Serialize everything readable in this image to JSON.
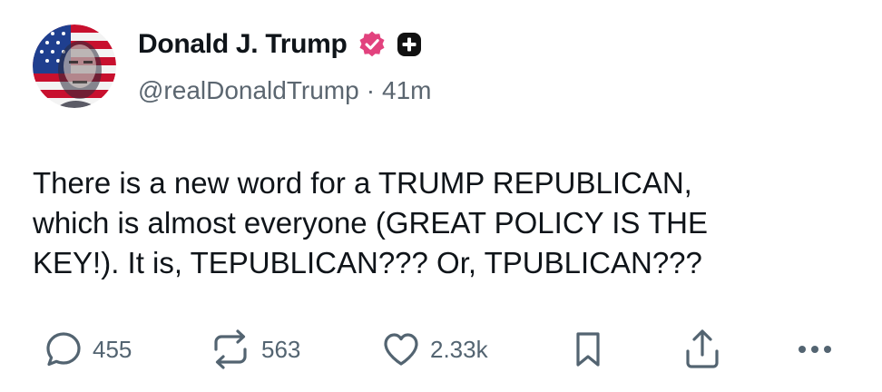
{
  "post": {
    "author_name": "Donald J. Trump",
    "handle": "@realDonaldTrump",
    "separator": "·",
    "timestamp": "41m",
    "text": "There is a new word for a TRUMP REPUBLICAN,\nwhich is almost everyone (GREAT POLICY IS THE\nKEY!). It is, TEPUBLICAN??? Or, TPUBLICAN???"
  },
  "icons": {
    "verified": "verified-badge-icon",
    "plus": "plus-badge-icon",
    "reply": "reply-icon",
    "repost": "repost-icon",
    "like": "heart-icon",
    "bookmark": "bookmark-icon",
    "share": "share-icon",
    "more": "more-icon"
  },
  "actions": {
    "replies": "455",
    "reposts": "563",
    "likes": "2.33k"
  },
  "colors": {
    "text": "#0f1419",
    "secondary": "#5b6670",
    "verified_badge": "#e2427e",
    "action_icon": "#536471"
  }
}
